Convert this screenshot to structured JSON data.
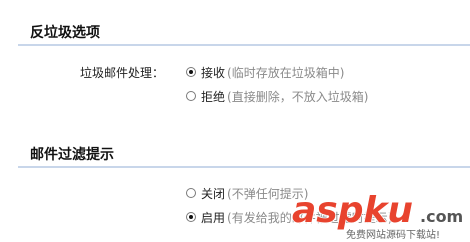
{
  "sections": [
    {
      "title": "反垃圾选项",
      "field_label": "垃圾邮件处理：",
      "options": [
        {
          "label": "接收",
          "desc": "(临时存放在垃圾箱中)",
          "checked": true
        },
        {
          "label": "拒绝",
          "desc": "(直接删除，不放入垃圾箱)",
          "checked": false
        }
      ]
    },
    {
      "title": "邮件过滤提示",
      "options": [
        {
          "label": "关闭",
          "desc": "(不弹任何提示)",
          "checked": false
        },
        {
          "label": "启用",
          "desc": "(有发给我的邮件被过滤时提示)",
          "checked": true
        }
      ]
    }
  ],
  "watermark": {
    "brand": "aspku",
    "dotcom": ".com",
    "tagline": "免费网站源码下载站!"
  }
}
